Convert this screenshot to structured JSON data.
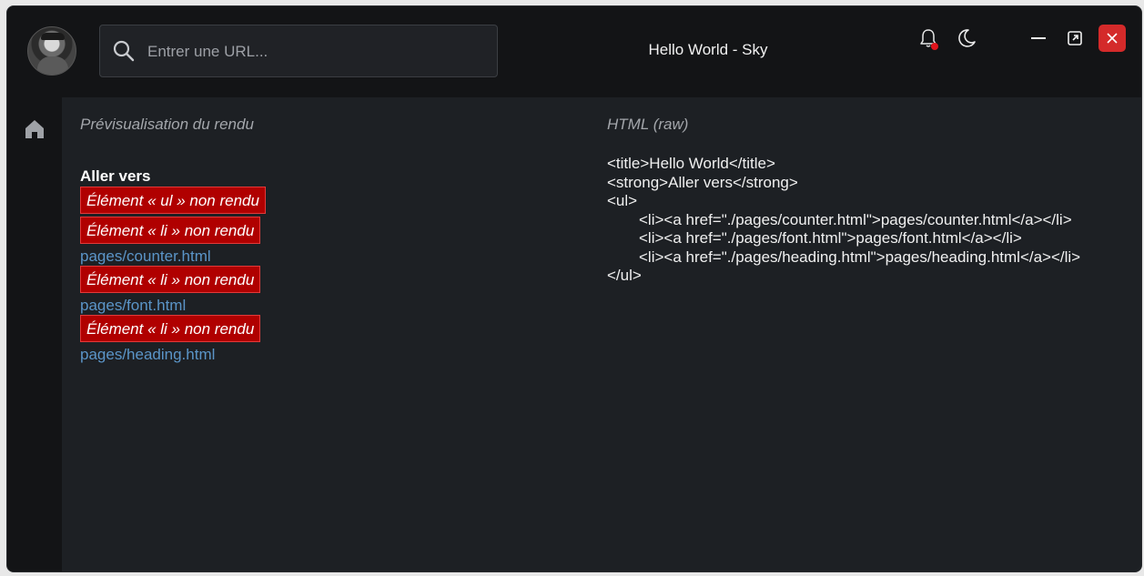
{
  "search": {
    "placeholder": "Entrer une URL..."
  },
  "window": {
    "title": "Hello World - Sky"
  },
  "colors": {
    "window_bg": "#131416",
    "content_bg": "#1d2024",
    "close_button": "#d42a2a",
    "notification_dot": "#e0141c",
    "error_bg": "#b00000",
    "link": "#5b95c8"
  },
  "icons": {
    "avatar": "user-avatar",
    "search": "search-icon",
    "bell": "bell-icon",
    "moon": "moon-icon",
    "minimize": "minimize-icon",
    "maximize": "maximize-icon",
    "close": "close-icon",
    "home": "home-icon"
  },
  "preview": {
    "label": "Prévisualisation du rendu",
    "strong_text": "Aller vers",
    "ul_error": "Élément « ul » non rendu",
    "li_error": "Élément « li » non rendu",
    "links": [
      "pages/counter.html",
      "pages/font.html",
      "pages/heading.html"
    ]
  },
  "raw": {
    "label": "HTML (raw)",
    "lines": [
      "<title>Hello World</title>",
      "<strong>Aller vers</strong>",
      "<ul>",
      "<li><a href=\"./pages/counter.html\">pages/counter.html</a></li>",
      "<li><a href=\"./pages/font.html\">pages/font.html</a></li>",
      "<li><a href=\"./pages/heading.html\">pages/heading.html</a></li>",
      "</ul>"
    ]
  }
}
